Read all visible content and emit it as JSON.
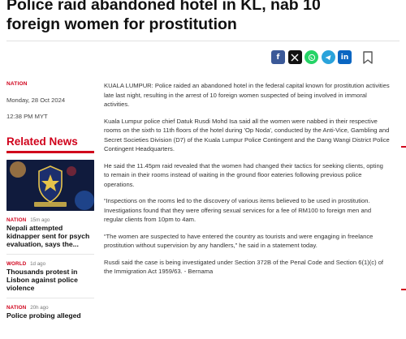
{
  "article": {
    "headline": "Police raid abandoned hotel in KL, nab 10 foreign women for prostitution",
    "category": "NATION",
    "date": "Monday, 28 Oct 2024",
    "time": "12:38 PM MYT",
    "paragraphs": [
      "KUALA LUMPUR: Police raided an abandoned hotel in the federal capital known for prostitution activities late last night, resulting in the arrest of 10 foreign women suspected of being involved in immoral activities.",
      "Kuala Lumpur police chief Datuk Rusdi Mohd Isa said all the women were nabbed in their respective rooms on the sixth to 11th floors of the hotel during 'Op Noda', conducted by the Anti-Vice, Gambling and Secret Societies Division (D7) of the Kuala Lumpur Police Contingent and the Dang Wangi District Police Contingent Headquarters.",
      "He said the 11.45pm raid revealed that the women had changed their tactics for seeking clients, opting to remain in their rooms instead of waiting in the ground floor eateries following previous police operations.",
      "“Inspections on the rooms led to the discovery of various items believed to be used in prostitution. Investigations found that they were offering sexual services for a fee of RM100 to foreign men and regular clients from 10pm to 4am.",
      "“The women are suspected to have entered the country as tourists and were engaging in freelance prostitution without supervision by any handlers,” he said in a statement today.",
      "Rusdi said the case is being investigated under Section 372B of the Penal Code and Section 6(1)(c) of the Immigration Act 1959/63. - Bernama"
    ]
  },
  "share": {
    "buttons": [
      {
        "icon": "facebook-icon",
        "glyph": "f",
        "color": "#3b5998"
      },
      {
        "icon": "x-icon",
        "glyph": "𝕏",
        "color": "#111111"
      },
      {
        "icon": "whatsapp-icon",
        "glyph": "✆",
        "color": "#25d366"
      },
      {
        "icon": "telegram-icon",
        "glyph": "➤",
        "color": "#2aa3db"
      },
      {
        "icon": "linkedin-icon",
        "glyph": "in",
        "color": "#0a66c2"
      }
    ],
    "bookmark_icon": "bookmark-icon"
  },
  "related": {
    "title": "Related News",
    "items": [
      {
        "category": "NATION",
        "age": "15m ago",
        "headline": "Nepali attempted kidnapper sent for psych evaluation, says the..."
      },
      {
        "category": "WORLD",
        "age": "1d ago",
        "headline": "Thousands protest in Lisbon against police violence"
      },
      {
        "category": "NATION",
        "age": "20h ago",
        "headline": "Police probing alleged"
      }
    ]
  },
  "colors": {
    "accent": "#d0021b",
    "text": "#333333",
    "muted": "#777777"
  }
}
